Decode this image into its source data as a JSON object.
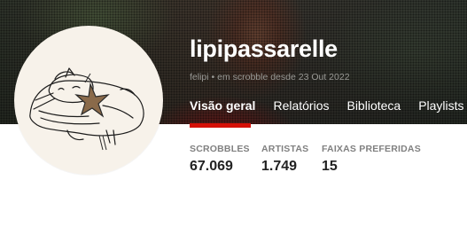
{
  "profile": {
    "username": "lipipassarelle",
    "subline": "felipi • em scrobble desde 23 Out 2022"
  },
  "tabs": [
    {
      "label": "Visão geral",
      "active": true
    },
    {
      "label": "Relatórios",
      "active": false
    },
    {
      "label": "Biblioteca",
      "active": false
    },
    {
      "label": "Playlists",
      "active": false
    }
  ],
  "stats": [
    {
      "label": "SCROBBLES",
      "value": "67.069"
    },
    {
      "label": "ARTISTAS",
      "value": "1.749"
    },
    {
      "label": "FAIXAS PREFERIDAS",
      "value": "15"
    }
  ],
  "colors": {
    "accent": "#d51007",
    "text_dark": "#222222",
    "label_gray": "#808080"
  },
  "icons": {
    "avatar_art": "hand-drawn-sleeping-dog-with-star"
  }
}
